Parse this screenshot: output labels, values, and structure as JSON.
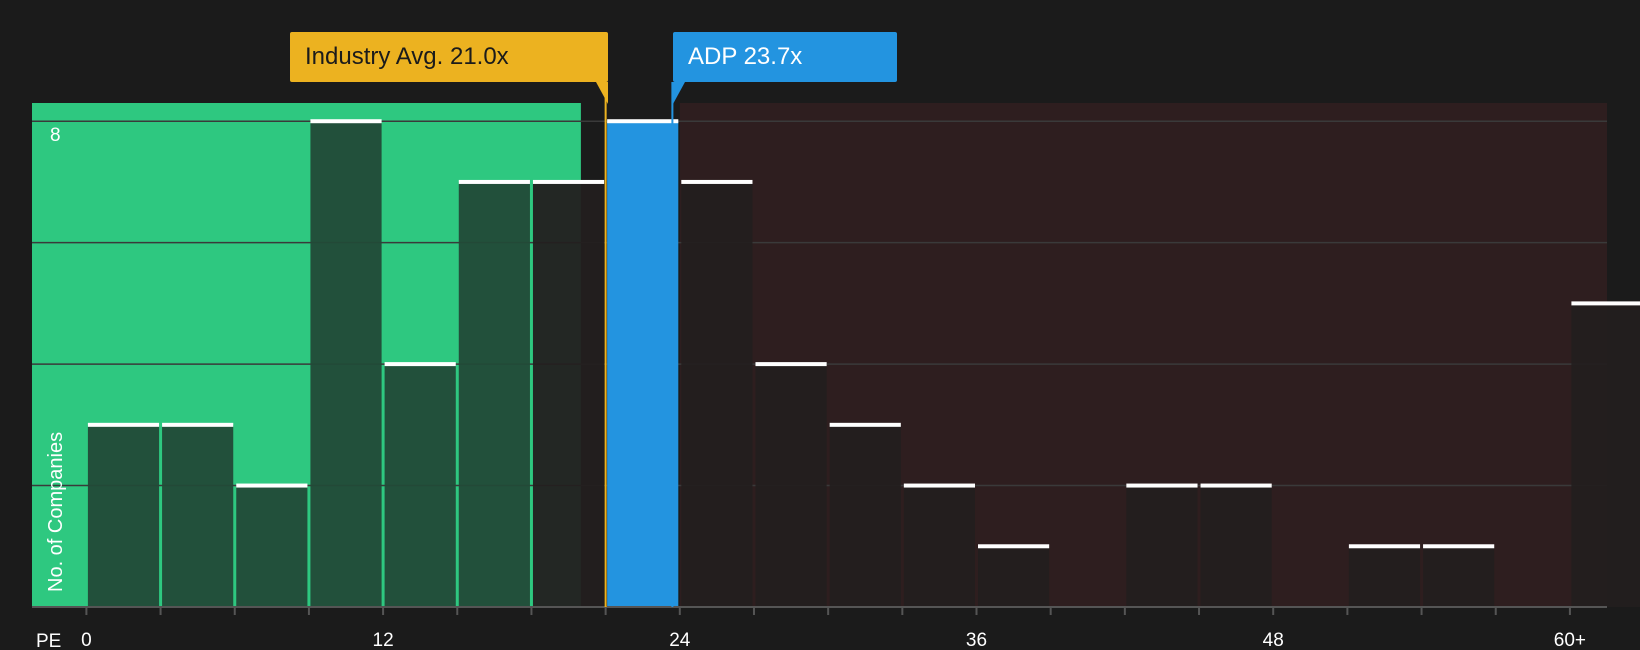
{
  "chart_data": {
    "type": "bar",
    "title": "",
    "xlabel": "PE",
    "ylabel": "No. of Companies",
    "x_ticks": [
      {
        "value": 0,
        "label": "0"
      },
      {
        "value": 12,
        "label": "12"
      },
      {
        "value": 24,
        "label": "24"
      },
      {
        "value": 36,
        "label": "36"
      },
      {
        "value": 48,
        "label": "48"
      },
      {
        "value": 60,
        "label": "60+"
      }
    ],
    "y_ticks": [
      {
        "value": 8,
        "label": "8"
      }
    ],
    "xlim": [
      -2.2,
      61.5
    ],
    "ylim": [
      0,
      8.3
    ],
    "bin_width": 3,
    "gridlines_y": [
      2,
      4,
      6,
      8
    ],
    "bins": [
      {
        "start": 0,
        "count": 3
      },
      {
        "start": 3,
        "count": 3
      },
      {
        "start": 6,
        "count": 2
      },
      {
        "start": 9,
        "count": 8
      },
      {
        "start": 12,
        "count": 4
      },
      {
        "start": 15,
        "count": 7
      },
      {
        "start": 18,
        "count": 7
      },
      {
        "start": 21,
        "count": 8,
        "highlight": true
      },
      {
        "start": 24,
        "count": 7
      },
      {
        "start": 27,
        "count": 4
      },
      {
        "start": 30,
        "count": 3
      },
      {
        "start": 33,
        "count": 2
      },
      {
        "start": 36,
        "count": 1
      },
      {
        "start": 39,
        "count": 0
      },
      {
        "start": 42,
        "count": 2
      },
      {
        "start": 45,
        "count": 2
      },
      {
        "start": 48,
        "count": 0
      },
      {
        "start": 51,
        "count": 1
      },
      {
        "start": 54,
        "count": 1
      },
      {
        "start": 57,
        "count": 0
      },
      {
        "start": 60,
        "count": 5
      }
    ],
    "regions": [
      {
        "name": "undervalued",
        "from": -2.2,
        "to": 20,
        "color": "#2ec880"
      },
      {
        "name": "overvalued",
        "from": 24,
        "to": 61.5,
        "color": "#2e1e1f"
      }
    ],
    "markers": [
      {
        "name": "industry-avg",
        "value": 21.0,
        "label": "Industry Avg. 21.0x",
        "color": "#ecb220"
      },
      {
        "name": "company",
        "value": 23.7,
        "label": "ADP 23.7x",
        "color": "#2394e0"
      }
    ]
  },
  "colors": {
    "background": "#1b1b1b",
    "bar_in_green": "#224a37",
    "bar_in_red": "#231f1f",
    "bar_highlight": "#2394e0",
    "bar_cap": "#ffffff",
    "gridline": "#3a3a3a",
    "axis": "#555555"
  }
}
